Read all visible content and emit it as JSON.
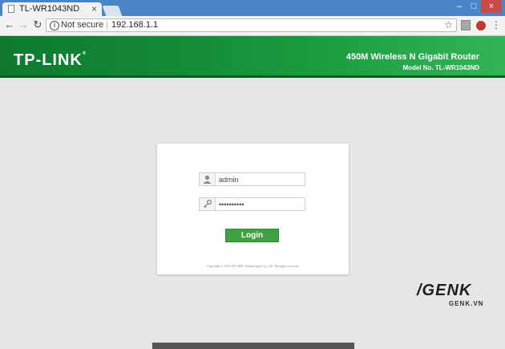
{
  "browser": {
    "tab_title": "TL-WR1043ND",
    "tab_close": "×",
    "security_label": "Not secure",
    "url": "192.168.1.1",
    "icons": [
      "page-icon",
      "back-icon",
      "forward-icon",
      "reload-icon",
      "info-icon",
      "star-icon",
      "extension-icon",
      "shield-icon",
      "menu-icon"
    ]
  },
  "header": {
    "logo": "TP-LINK",
    "logo_mark": "®",
    "product": "450M Wireless N Gigabit Router",
    "model": "Model No. TL-WR1043ND",
    "color": "#1a9a3f"
  },
  "login": {
    "username": "admin",
    "password": "••••••••••",
    "button": "Login",
    "copyright": "Copyright © 2016 TP-LINK Technologies Co., Ltd. All rights reserved.",
    "button_color": "#3fa344"
  },
  "watermark": {
    "brand": "/GENK",
    "domain": "GENK.VN"
  }
}
